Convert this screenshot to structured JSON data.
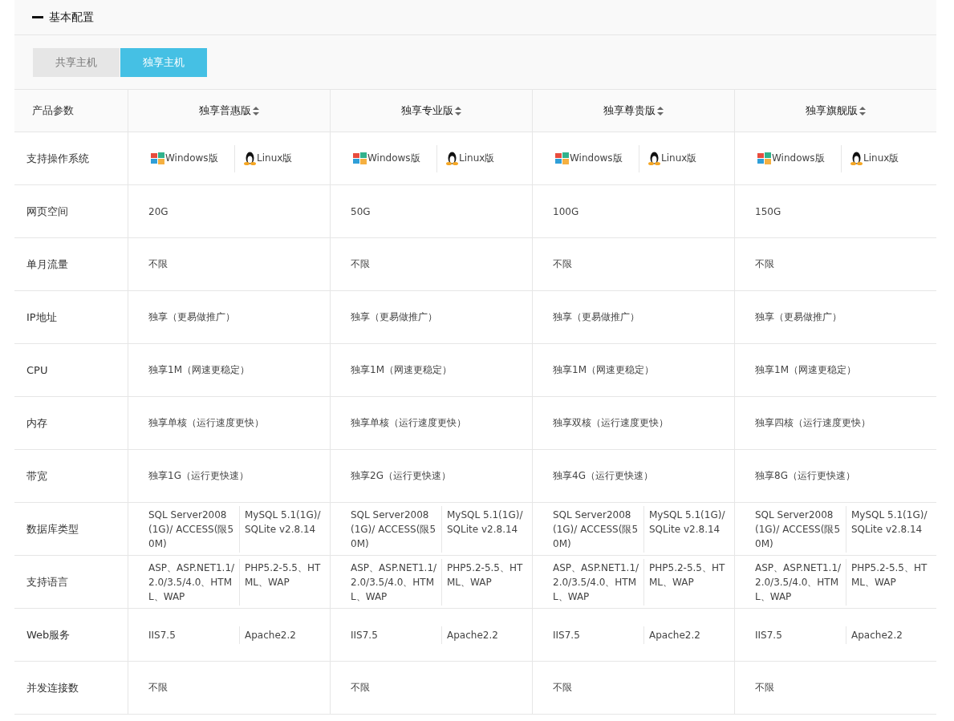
{
  "section": {
    "title": "基本配置",
    "expanded": true
  },
  "tabs": [
    {
      "label": "共享主机",
      "selected": false
    },
    {
      "label": "独享主机",
      "selected": true
    }
  ],
  "table": {
    "corner": "产品参数",
    "columns": [
      "独享普惠版",
      "独享专业版",
      "独享尊贵版",
      "独享旗舰版"
    ],
    "rows": [
      {
        "kind": "os",
        "label": "支持操作系统",
        "cells": [
          [
            "Windows版",
            "Linux版"
          ],
          [
            "Windows版",
            "Linux版"
          ],
          [
            "Windows版",
            "Linux版"
          ],
          [
            "Windows版",
            "Linux版"
          ]
        ]
      },
      {
        "kind": "single",
        "label": "网页空间",
        "cells": [
          "20G",
          "50G",
          "100G",
          "150G"
        ]
      },
      {
        "kind": "single",
        "label": "单月流量",
        "cells": [
          "不限",
          "不限",
          "不限",
          "不限"
        ]
      },
      {
        "kind": "single",
        "label": "IP地址",
        "cells": [
          "独享（更易做推广）",
          "独享（更易做推广）",
          "独享（更易做推广）",
          "独享（更易做推广）"
        ]
      },
      {
        "kind": "single",
        "label": "CPU",
        "cells": [
          "独享1M（网速更稳定）",
          "独享1M（网速更稳定）",
          "独享1M（网速更稳定）",
          "独享1M（网速更稳定）"
        ]
      },
      {
        "kind": "single",
        "label": "内存",
        "cells": [
          "独享单核（运行速度更快）",
          "独享单核（运行速度更快）",
          "独享双核（运行速度更快）",
          "独享四核（运行速度更快）"
        ]
      },
      {
        "kind": "single",
        "label": "带宽",
        "cells": [
          "独享1G（运行更快速）",
          "独享2G（运行更快速）",
          "独享4G（运行更快速）",
          "独享8G（运行更快速）"
        ]
      },
      {
        "kind": "split",
        "label": "数据库类型",
        "cells": [
          [
            "SQL Server2008(1G)/ ACCESS(限50M)",
            "MySQL 5.1(1G)/ SQLite v2.8.14"
          ],
          [
            "SQL Server2008(1G)/ ACCESS(限50M)",
            "MySQL 5.1(1G)/ SQLite v2.8.14"
          ],
          [
            "SQL Server2008(1G)/ ACCESS(限50M)",
            "MySQL 5.1(1G)/ SQLite v2.8.14"
          ],
          [
            "SQL Server2008(1G)/ ACCESS(限50M)",
            "MySQL 5.1(1G)/ SQLite v2.8.14"
          ]
        ]
      },
      {
        "kind": "split",
        "label": "支持语言",
        "cells": [
          [
            "ASP、ASP.NET1.1/2.0/3.5/4.0、HTML、WAP",
            "PHP5.2-5.5、HTML、WAP"
          ],
          [
            "ASP、ASP.NET1.1/2.0/3.5/4.0、HTML、WAP",
            "PHP5.2-5.5、HTML、WAP"
          ],
          [
            "ASP、ASP.NET1.1/2.0/3.5/4.0、HTML、WAP",
            "PHP5.2-5.5、HTML、WAP"
          ],
          [
            "ASP、ASP.NET1.1/2.0/3.5/4.0、HTML、WAP",
            "PHP5.2-5.5、HTML、WAP"
          ]
        ]
      },
      {
        "kind": "split",
        "label": "Web服务",
        "cells": [
          [
            "IIS7.5",
            "Apache2.2"
          ],
          [
            "IIS7.5",
            "Apache2.2"
          ],
          [
            "IIS7.5",
            "Apache2.2"
          ],
          [
            "IIS7.5",
            "Apache2.2"
          ]
        ]
      },
      {
        "kind": "single",
        "label": "并发连接数",
        "cells": [
          "不限",
          "不限",
          "不限",
          "不限"
        ]
      }
    ]
  }
}
